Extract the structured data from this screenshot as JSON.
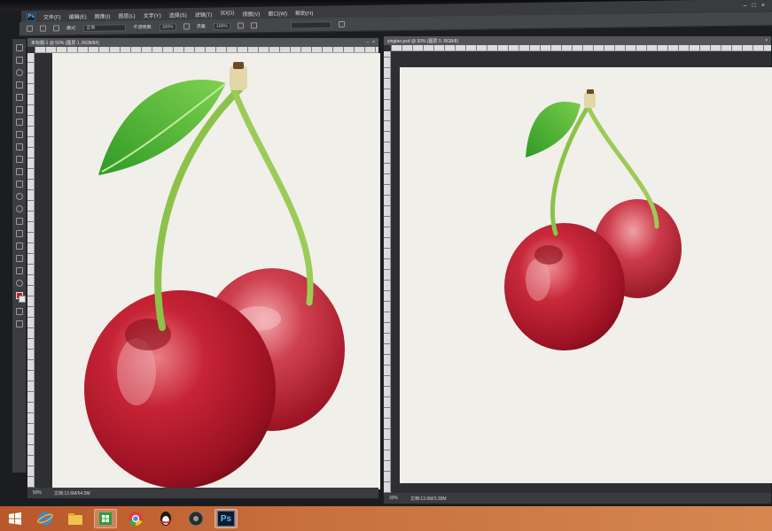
{
  "app": {
    "icon_label": "Ps",
    "menu": [
      "文件(F)",
      "编辑(E)",
      "图像(I)",
      "图层(L)",
      "文字(Y)",
      "选择(S)",
      "滤镜(T)",
      "3D(D)",
      "视图(V)",
      "窗口(W)",
      "帮助(H)"
    ],
    "window_controls": [
      "–",
      "□",
      "×"
    ]
  },
  "options_bar": {
    "mode_label": "模式:",
    "mode_value": "正常",
    "opacity_label": "不透明度:",
    "opacity_value": "100%",
    "flow_label": "流量:",
    "flow_value": "100%"
  },
  "documents": {
    "left": {
      "tab_title": "未标题-1 @ 50% (图层 1, RGB/8#)",
      "zoom": "50%",
      "doc_info": "文档:13.6M/64.5M"
    },
    "right": {
      "tab_title": "yingtao.psd @ 30% (图层 0, RGB/8)",
      "zoom": "30%",
      "doc_info": "文档:13.6M/3.39M"
    }
  },
  "icons": {
    "start": "windows-start-icon",
    "ie": "internet-explorer-icon",
    "explorer": "file-explorer-icon",
    "store": "store-icon",
    "browser": "chrome-icon",
    "qq": "qq-penguin-icon",
    "media": "media-player-icon",
    "ps": "photoshop-icon"
  },
  "taskbar": {
    "ps_label": "Ps"
  },
  "colors": {
    "foreground": "#c0202e",
    "background": "#e6e6e6",
    "cherry": "#b3142a",
    "leaf": "#48b030",
    "taskbar": "#c8703e"
  }
}
